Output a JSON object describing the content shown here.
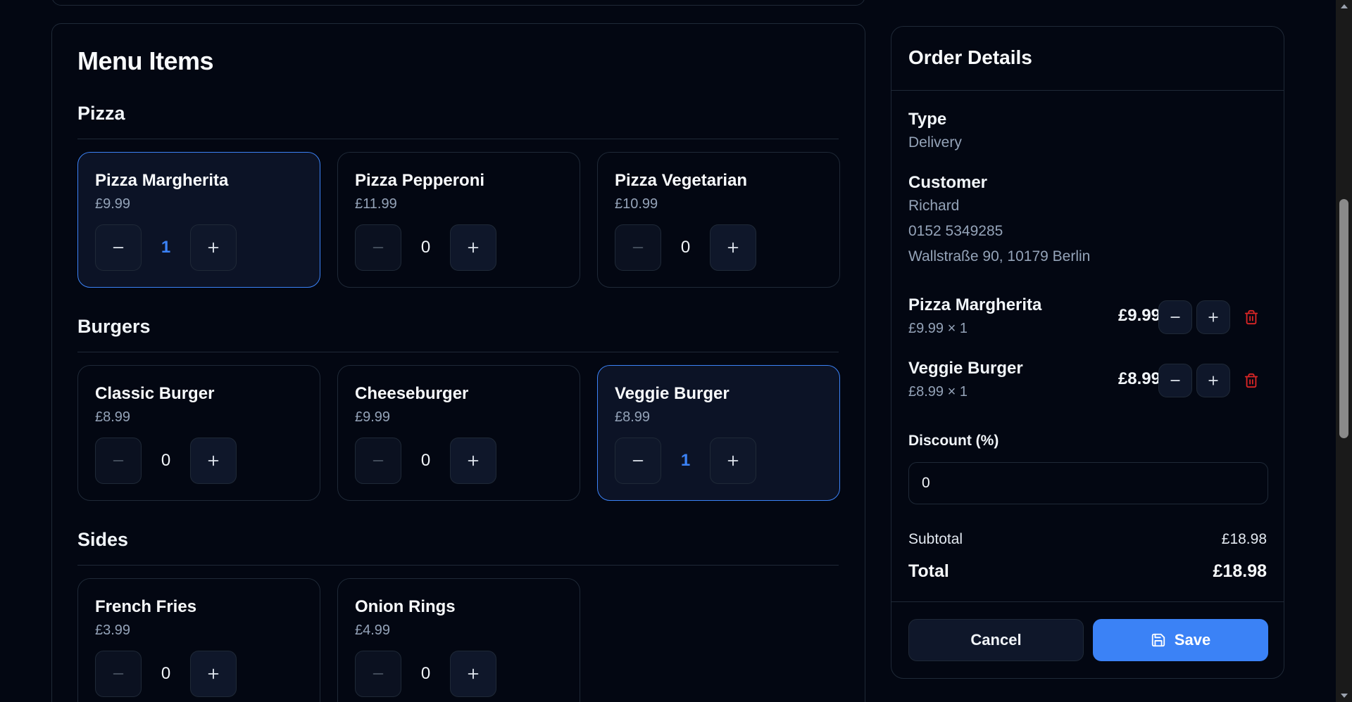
{
  "menu": {
    "title": "Menu Items",
    "categories": [
      {
        "name": "Pizza",
        "items": [
          {
            "name": "Pizza Margherita",
            "price": "£9.99",
            "qty": "1",
            "selected": true
          },
          {
            "name": "Pizza Pepperoni",
            "price": "£11.99",
            "qty": "0",
            "selected": false
          },
          {
            "name": "Pizza Vegetarian",
            "price": "£10.99",
            "qty": "0",
            "selected": false
          }
        ]
      },
      {
        "name": "Burgers",
        "items": [
          {
            "name": "Classic Burger",
            "price": "£8.99",
            "qty": "0",
            "selected": false
          },
          {
            "name": "Cheeseburger",
            "price": "£9.99",
            "qty": "0",
            "selected": false
          },
          {
            "name": "Veggie Burger",
            "price": "£8.99",
            "qty": "1",
            "selected": true
          }
        ]
      },
      {
        "name": "Sides",
        "items": [
          {
            "name": "French Fries",
            "price": "£3.99",
            "qty": "0",
            "selected": false
          },
          {
            "name": "Onion Rings",
            "price": "£4.99",
            "qty": "0",
            "selected": false
          }
        ]
      }
    ]
  },
  "order": {
    "title": "Order Details",
    "type_label": "Type",
    "type_value": "Delivery",
    "customer_label": "Customer",
    "customer_name": "Richard",
    "customer_phone": "0152 5349285",
    "customer_address": "Wallstraße 90, 10179 Berlin",
    "items": [
      {
        "name": "Pizza Margherita",
        "unit": "£9.99 × 1",
        "total": "£9.99"
      },
      {
        "name": "Veggie Burger",
        "unit": "£8.99 × 1",
        "total": "£8.99"
      }
    ],
    "discount_label": "Discount (%)",
    "discount_value": "0",
    "subtotal_label": "Subtotal",
    "subtotal_value": "£18.98",
    "total_label": "Total",
    "total_value": "£18.98",
    "cancel_label": "Cancel",
    "save_label": "Save"
  },
  "icons": {
    "minus": "minus-icon",
    "plus": "plus-icon",
    "trash": "trash-icon",
    "save": "save-icon"
  },
  "colors": {
    "background": "#030712",
    "accent": "#3b82f6",
    "danger": "#dc2626",
    "muted": "#94a3b8"
  }
}
